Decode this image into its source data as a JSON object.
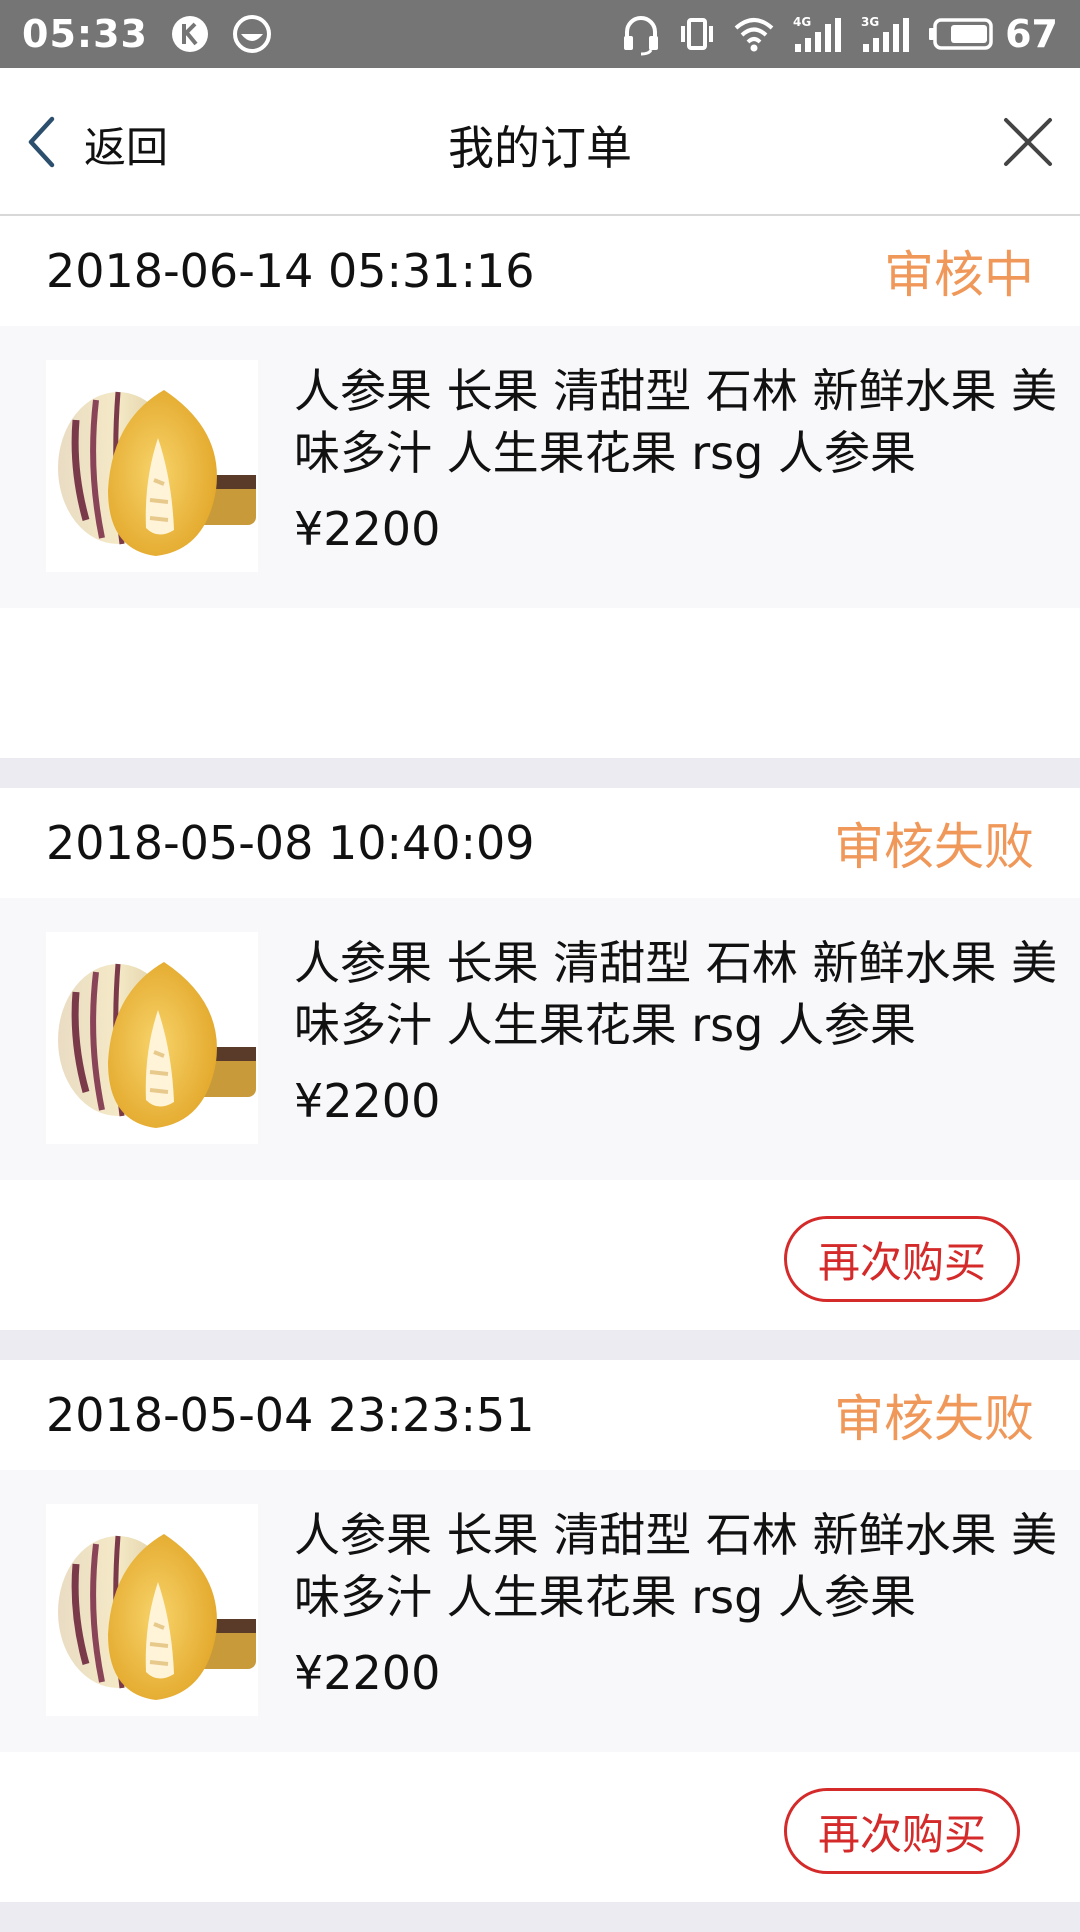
{
  "status_bar": {
    "time": "05:33",
    "battery": "67",
    "network_4g": "4G",
    "network_3g": "3G"
  },
  "nav": {
    "back_label": "返回",
    "title": "我的订单"
  },
  "orders": [
    {
      "time": "2018-06-14 05:31:16",
      "status": "审核中",
      "item": {
        "title": "人参果 长果 清甜型 石林 新鲜水果 美味多汁 人生果花果 rsg 人参果",
        "price": "¥2200"
      },
      "button": ""
    },
    {
      "time": "2018-05-08 10:40:09",
      "status": "审核失败",
      "item": {
        "title": "人参果 长果 清甜型 石林 新鲜水果 美味多汁 人生果花果 rsg 人参果",
        "price": "¥2200"
      },
      "button": "再次购买"
    },
    {
      "time": "2018-05-04 23:23:51",
      "status": "审核失败",
      "item": {
        "title": "人参果 长果 清甜型 石林 新鲜水果 美味多汁 人生果花果 rsg 人参果",
        "price": "¥2200"
      },
      "button": "再次购买"
    }
  ],
  "colors": {
    "status_orange": "#f0985a",
    "rebuy_red": "#d42a2a",
    "status_bar_bg": "#757575",
    "separator": "#ebebf1"
  }
}
